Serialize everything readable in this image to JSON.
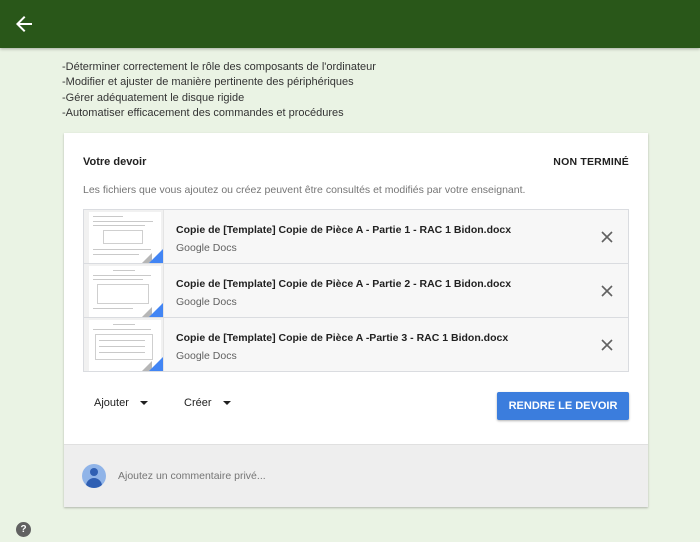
{
  "header": {
    "back_icon": "arrow-back-icon",
    "color": "#295719"
  },
  "objectives": [
    "-Déterminer correctement le rôle des composants de l'ordinateur",
    "-Modifier et ajuster de manière pertinente des périphériques",
    "-Gérer adéquatement le disque rigide",
    "-Automatiser efficacement des commandes et procédures"
  ],
  "assignment": {
    "title": "Votre devoir",
    "status": "NON TERMINÉ",
    "hint": "Les fichiers que vous ajoutez ou créez peuvent être consultés et modifiés par votre enseignant.",
    "attachments": [
      {
        "name": "Copie de [Template] Copie de Pièce A - Partie 1 - RAC 1 Bidon.docx",
        "type": "Google Docs"
      },
      {
        "name": "Copie de [Template] Copie de Pièce A - Partie 2 - RAC 1 Bidon.docx",
        "type": "Google Docs"
      },
      {
        "name": "Copie de [Template] Copie de Pièce A -Partie 3 - RAC 1 Bidon.docx",
        "type": "Google Docs"
      }
    ],
    "add_label": "Ajouter",
    "create_label": "Créer",
    "submit_label": "RENDRE LE DEVOIR",
    "submit_color": "#3b7ddd"
  },
  "comment": {
    "placeholder": "Ajoutez un commentaire privé..."
  },
  "help": {
    "label": "?"
  }
}
